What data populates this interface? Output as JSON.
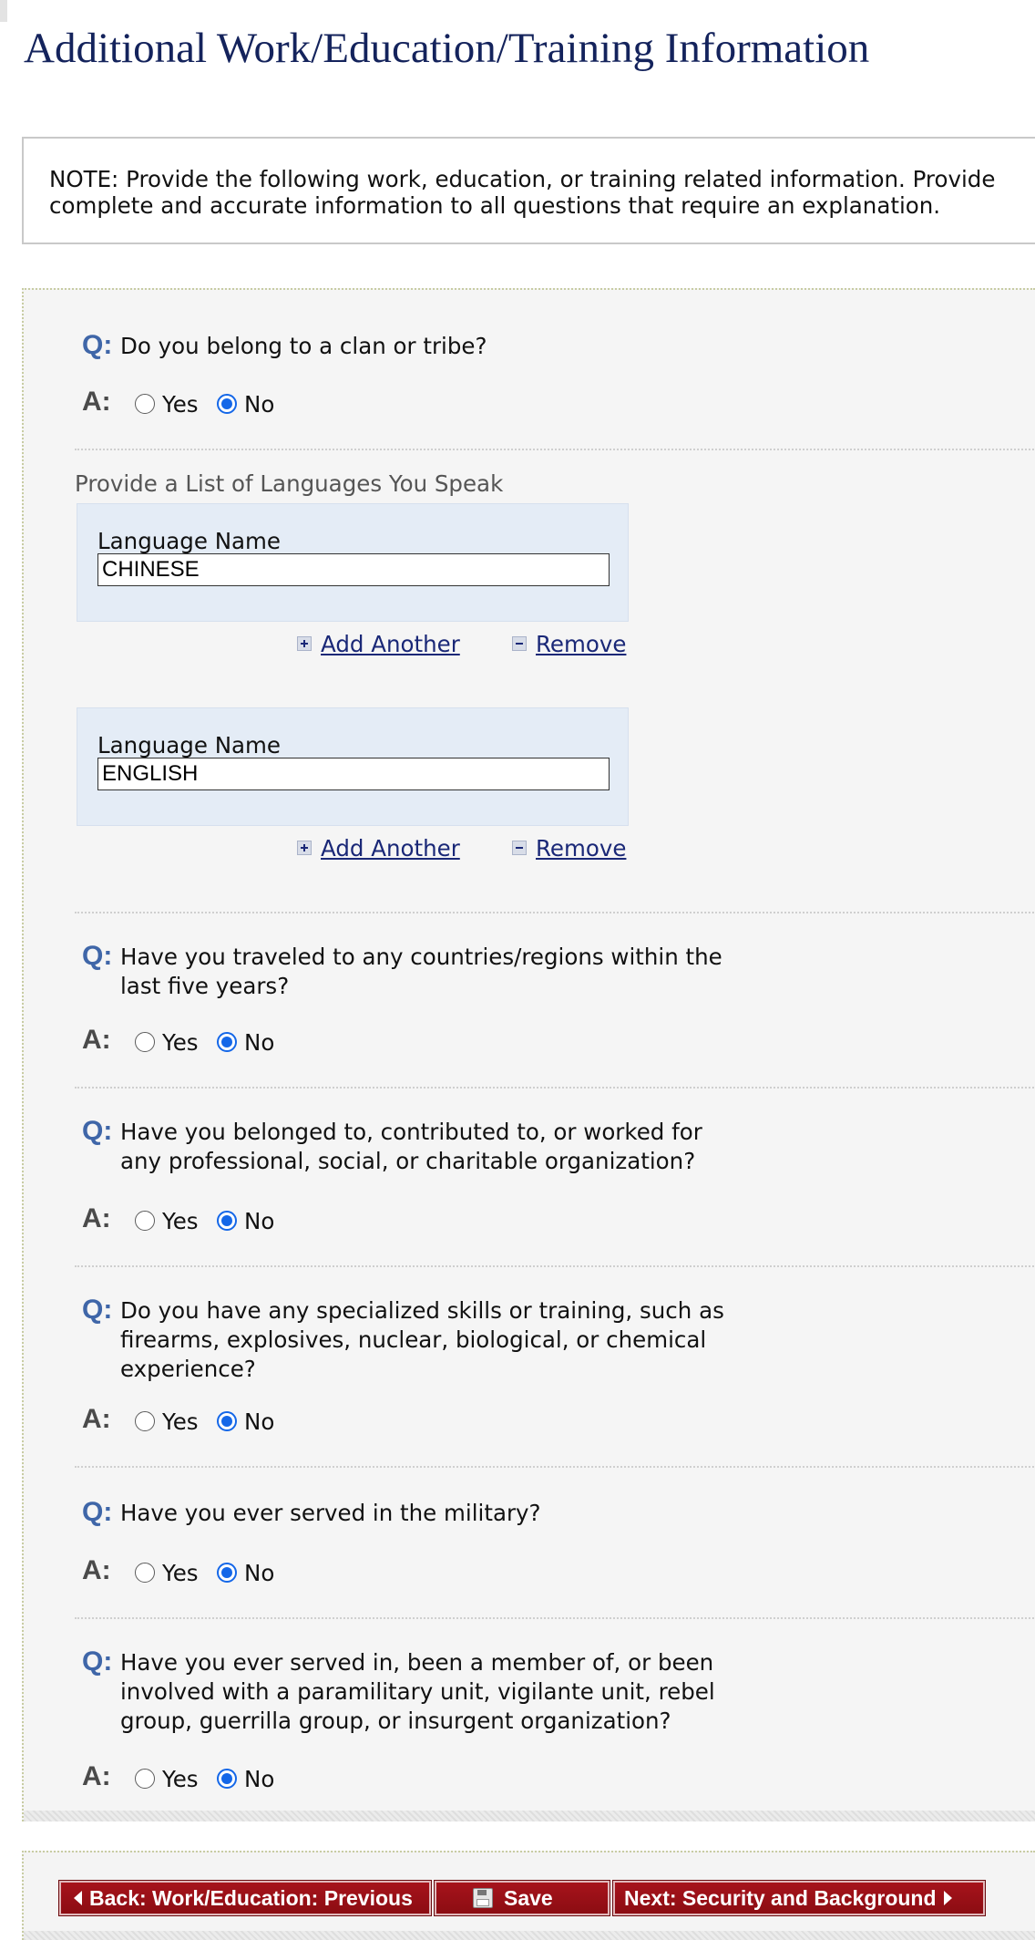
{
  "page": {
    "title": "Additional Work/Education/Training Information",
    "note": "NOTE: Provide the following work, education, or training related information. Provide complete and accurate information to all questions that require an explanation."
  },
  "labels": {
    "q": "Q:",
    "a": "A:",
    "yes": "Yes",
    "no": "No"
  },
  "questions": [
    {
      "text": "Do you belong to a clan or tribe?",
      "answer": "No"
    },
    {
      "text": "Have you traveled to any countries/regions within the last five years?",
      "answer": "No"
    },
    {
      "text": "Have you belonged to, contributed to, or worked for any professional, social, or charitable organization?",
      "answer": "No"
    },
    {
      "text": "Do you have any specialized skills or training, such as firearms, explosives, nuclear, biological, or chemical experience?",
      "answer": "No"
    },
    {
      "text": "Have you ever served in the military?",
      "answer": "No"
    },
    {
      "text": "Have you ever served in, been a member of, or been involved with a paramilitary unit, vigilante unit, rebel group, guerrilla group, or insurgent organization?",
      "answer": "No"
    }
  ],
  "languages": {
    "heading": "Provide a List of Languages You Speak",
    "field_label": "Language Name",
    "add_label": "Add Another",
    "remove_label": "Remove",
    "entries": [
      "CHINESE",
      "ENGLISH"
    ]
  },
  "nav": {
    "back_label": "Back: Work/Education: Previous",
    "save_label": "Save",
    "next_label": "Next: Security and Background"
  },
  "colors": {
    "title": "#14235c",
    "question_marker": "#3f66a8",
    "radio_selected": "#1467e8",
    "nav_button": "#a8141c",
    "link": "#1a2877",
    "language_box": "#e4ecf6"
  },
  "icons": [
    "plus-icon",
    "minus-icon",
    "floppy-disk-icon",
    "triangle-left-icon",
    "triangle-right-icon"
  ]
}
